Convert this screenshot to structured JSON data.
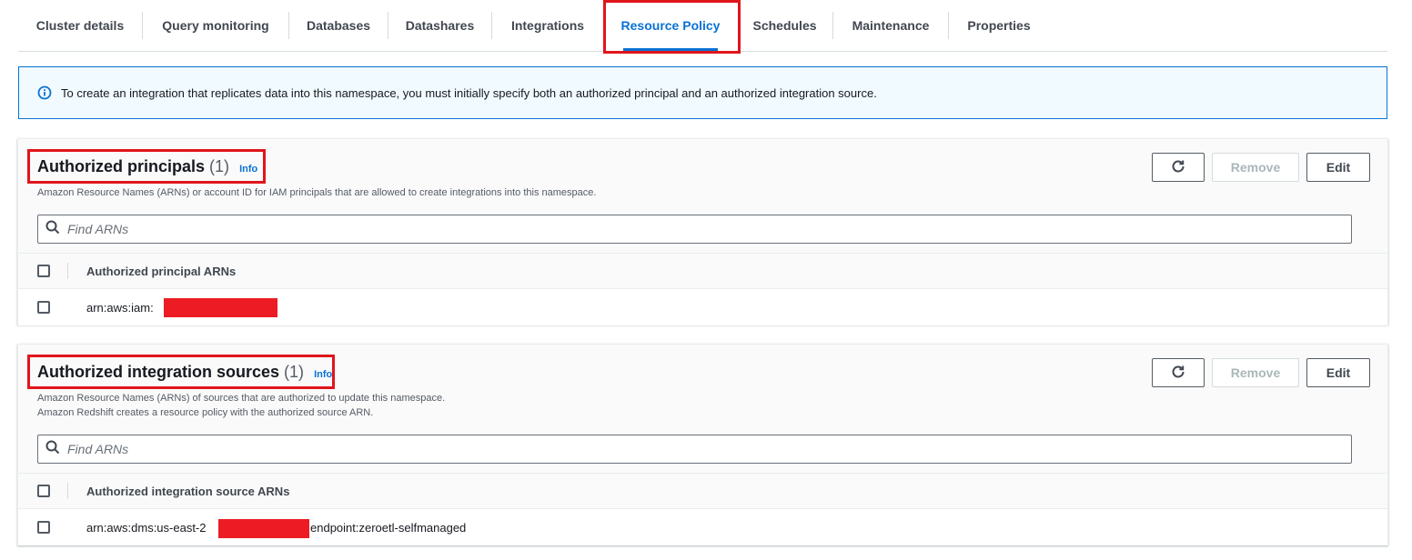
{
  "tabs": [
    {
      "label": "Cluster details"
    },
    {
      "label": "Query monitoring"
    },
    {
      "label": "Databases"
    },
    {
      "label": "Datashares"
    },
    {
      "label": "Integrations"
    },
    {
      "label": "Resource Policy",
      "active": true
    },
    {
      "label": "Schedules"
    },
    {
      "label": "Maintenance"
    },
    {
      "label": "Properties"
    }
  ],
  "banner": {
    "text": "To create an integration that replicates data into this namespace, you must initially specify both an authorized principal and an authorized integration source."
  },
  "principals": {
    "title": "Authorized principals",
    "count": "(1)",
    "info": "Info",
    "description": "Amazon Resource Names (ARNs) or account ID for IAM principals that are allowed to create integrations into this namespace.",
    "remove_label": "Remove",
    "edit_label": "Edit",
    "search_placeholder": "Find ARNs",
    "column_header": "Authorized principal ARNs",
    "rows": [
      {
        "arn_prefix": "arn:aws:iam:",
        "arn_suffix": ""
      }
    ]
  },
  "sources": {
    "title": "Authorized integration sources",
    "count": "(1)",
    "info": "Info",
    "description_line1": "Amazon Resource Names (ARNs) of sources that are authorized to update this namespace.",
    "description_line2": "Amazon Redshift creates a resource policy with the authorized source ARN.",
    "remove_label": "Remove",
    "edit_label": "Edit",
    "search_placeholder": "Find ARNs",
    "column_header": "Authorized integration source ARNs",
    "rows": [
      {
        "arn_prefix": "arn:aws:dms:us-east-2",
        "arn_suffix": "endpoint:zeroetl-selfmanaged"
      }
    ]
  },
  "colors": {
    "accent": "#0972d3",
    "highlight": "#e0151c",
    "redaction": "#ed1c24"
  },
  "icons": {
    "info": "info-circle-icon",
    "refresh": "refresh-icon",
    "search": "search-icon"
  }
}
